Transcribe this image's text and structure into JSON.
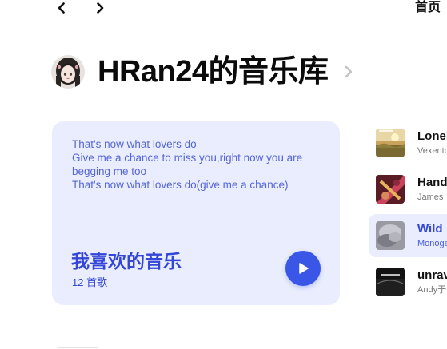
{
  "nav": {
    "back_icon": "chevron-left-icon",
    "forward_icon": "chevron-right-icon",
    "home_label": "首页"
  },
  "header": {
    "avatar_icon": "user-avatar",
    "title": "HRan24的音乐库",
    "chevron_icon": "chevron-right-icon"
  },
  "liked_card": {
    "lyrics": [
      "That's now what lovers do",
      "Give me a chance to miss you,right now you are begging me too",
      "That's now what lovers do(give me a chance)"
    ],
    "title": "我喜欢的音乐",
    "count": "12 首歌",
    "play_icon": "play-icon",
    "accent_color": "#3346d6",
    "background_color": "#e9edfd"
  },
  "tracks": [
    {
      "name": "Lonely",
      "artist": "Vexento",
      "active": false
    },
    {
      "name": "Hands",
      "artist": "James",
      "active": false
    },
    {
      "name": "Wild",
      "artist": "Monoge",
      "active": true
    },
    {
      "name": "unravel",
      "artist": "Andy于",
      "active": false
    }
  ]
}
